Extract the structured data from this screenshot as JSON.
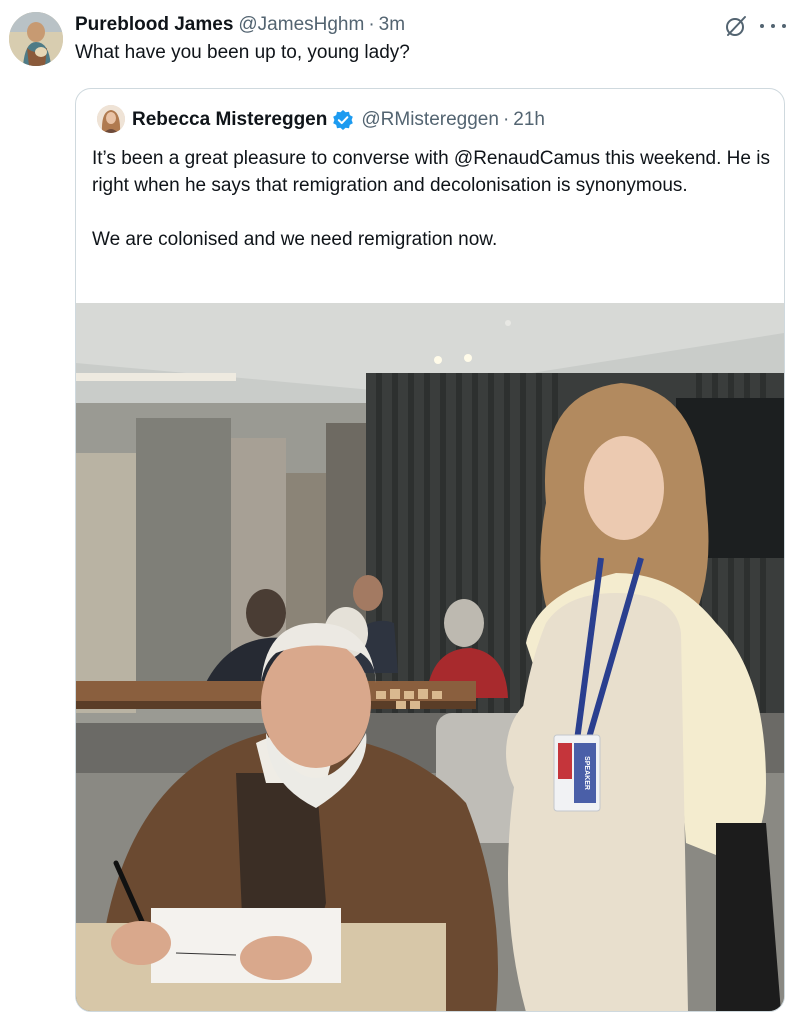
{
  "tweet": {
    "display_name": "Pureblood James",
    "handle": "@JamesHghm",
    "separator": "·",
    "time": "3m",
    "text": "What have you been up to, young lady?",
    "avatar_icon": "user-avatar",
    "grok_icon": "grok-icon",
    "more_icon": "more-options-icon"
  },
  "quoted": {
    "display_name": "Rebecca Mistereggen",
    "verified_icon": "verified-badge-icon",
    "verified_color": "#1d9bf0",
    "handle": "@RMistereggen",
    "separator": "·",
    "time": "21h",
    "paragraph_1": "It’s been a great pleasure to converse with @RenaudCamus this weekend. He is right when he says that remigration and decolonisation is synonymous.",
    "paragraph_2": "We are colonised and we need remigration now.",
    "badge_text": "SPEAKER"
  },
  "colors": {
    "text_primary": "#0f1419",
    "text_secondary": "#536471",
    "border": "#cfd9de"
  }
}
